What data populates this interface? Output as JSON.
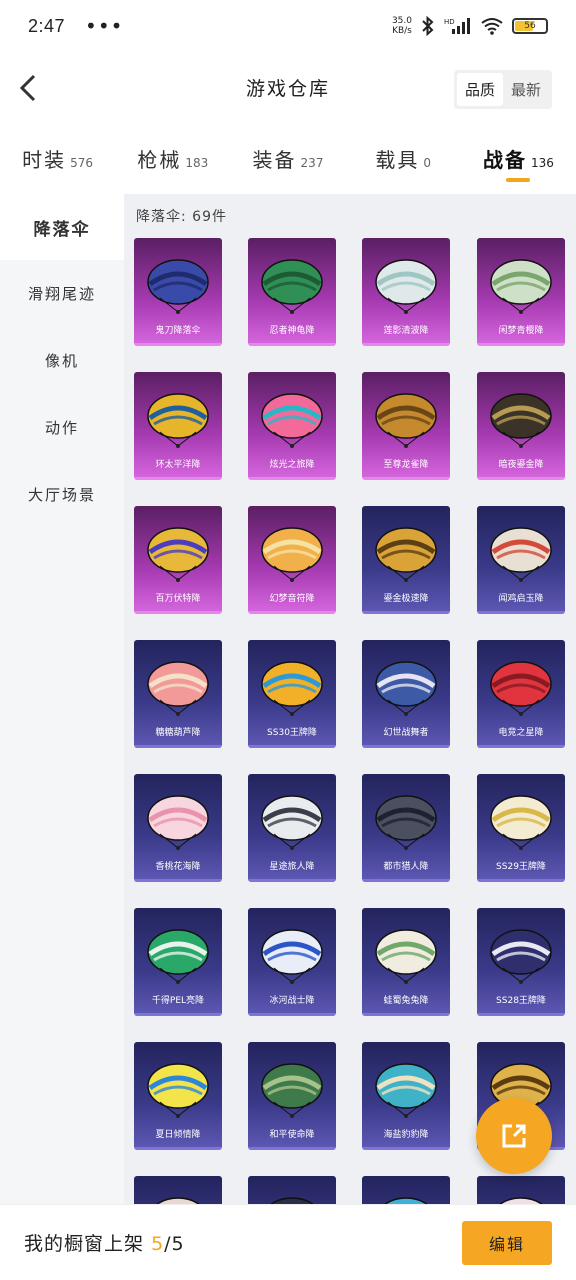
{
  "status": {
    "time": "2:47",
    "dots": "•••",
    "speed_value": "35.0",
    "speed_unit": "KB/s",
    "battery": "56"
  },
  "header": {
    "title": "游戏仓库",
    "sort_quality": "品质",
    "sort_newest": "最新"
  },
  "tabs": [
    {
      "label": "时装",
      "count": "576"
    },
    {
      "label": "枪械",
      "count": "183"
    },
    {
      "label": "装备",
      "count": "237"
    },
    {
      "label": "载具",
      "count": "0"
    },
    {
      "label": "战备",
      "count": "136"
    }
  ],
  "sidebar": [
    {
      "label": "降落伞"
    },
    {
      "label": "滑翔尾迹"
    },
    {
      "label": "像机"
    },
    {
      "label": "动作"
    },
    {
      "label": "大厅场景"
    }
  ],
  "content": {
    "count_label": "降落伞: 69件"
  },
  "items": [
    {
      "name": "鬼刀降落伞",
      "rarity": "epic",
      "colors": [
        "#3a4aa8",
        "#1e2b6e"
      ]
    },
    {
      "name": "忍者神龟降",
      "rarity": "epic",
      "colors": [
        "#2f8f54",
        "#1d5a35"
      ]
    },
    {
      "name": "莲影清波降",
      "rarity": "epic",
      "colors": [
        "#dfe9ea",
        "#9fc6c4"
      ]
    },
    {
      "name": "闲梦青樱降",
      "rarity": "epic",
      "colors": [
        "#cfe0c8",
        "#7aa56d"
      ]
    },
    {
      "name": "环太平洋降",
      "rarity": "epic",
      "colors": [
        "#e7b52a",
        "#1f5f9c"
      ]
    },
    {
      "name": "炫光之旅降",
      "rarity": "epic",
      "colors": [
        "#f36a9a",
        "#2bb6c8"
      ]
    },
    {
      "name": "至尊龙雀降",
      "rarity": "epic",
      "colors": [
        "#c58a2e",
        "#6a4516"
      ]
    },
    {
      "name": "暗夜鎏金降",
      "rarity": "epic",
      "colors": [
        "#3b3327",
        "#b79a53"
      ]
    },
    {
      "name": "百万伏特降",
      "rarity": "epic",
      "colors": [
        "#e8b83a",
        "#4b3cc0"
      ]
    },
    {
      "name": "幻梦音符降",
      "rarity": "epic",
      "colors": [
        "#f2b04a",
        "#f5e3a5"
      ]
    },
    {
      "name": "鎏金极速降",
      "rarity": "legend",
      "colors": [
        "#d9a338",
        "#5c3f12"
      ]
    },
    {
      "name": "闻鸡启玉降",
      "rarity": "legend",
      "colors": [
        "#e8e0d2",
        "#d34a3a"
      ]
    },
    {
      "name": "糖糖葫芦降",
      "rarity": "legend",
      "colors": [
        "#f29a9a",
        "#f5e0c8"
      ]
    },
    {
      "name": "SS30王牌降",
      "rarity": "legend",
      "colors": [
        "#f1b028",
        "#2d9ad6"
      ]
    },
    {
      "name": "幻世战舞者",
      "rarity": "legend",
      "colors": [
        "#3c5aa6",
        "#e7e3f2"
      ]
    },
    {
      "name": "电竞之星降",
      "rarity": "legend",
      "colors": [
        "#e0343e",
        "#8a1a22"
      ]
    },
    {
      "name": "香桃花海降",
      "rarity": "legend",
      "colors": [
        "#f7d6df",
        "#e993ad"
      ]
    },
    {
      "name": "星途旅人降",
      "rarity": "legend",
      "colors": [
        "#e8ecef",
        "#3a3e48"
      ]
    },
    {
      "name": "都市猎人降",
      "rarity": "legend",
      "colors": [
        "#4a5060",
        "#1e2230"
      ]
    },
    {
      "name": "SS29王牌降",
      "rarity": "legend",
      "colors": [
        "#f3ecd2",
        "#d9b84a"
      ]
    },
    {
      "name": "千得PEL亮降",
      "rarity": "legend",
      "colors": [
        "#2aa86a",
        "#e8f3ed"
      ]
    },
    {
      "name": "冰河战士降",
      "rarity": "legend",
      "colors": [
        "#e9edf7",
        "#2c55c8"
      ]
    },
    {
      "name": "蛙蜀兔兔降",
      "rarity": "legend",
      "colors": [
        "#f1ece0",
        "#6fa86a"
      ]
    },
    {
      "name": "SS28王牌降",
      "rarity": "legend",
      "colors": [
        "#2f2f6e",
        "#e9e9f3"
      ]
    },
    {
      "name": "夏日倾情降",
      "rarity": "legend",
      "colors": [
        "#f3e44a",
        "#2e86d9"
      ]
    },
    {
      "name": "和平使命降",
      "rarity": "legend",
      "colors": [
        "#3f7a4a",
        "#a7c38c"
      ]
    },
    {
      "name": "海盐豹豹降",
      "rarity": "legend",
      "colors": [
        "#3fb2c8",
        "#f0e2c0"
      ]
    },
    {
      "name": "",
      "rarity": "legend",
      "colors": [
        "#e0b24a",
        "#5a3a0f"
      ]
    },
    {
      "name": "",
      "rarity": "legend",
      "colors": [
        "#e8d8d0",
        "#c94b5b"
      ]
    },
    {
      "name": "",
      "rarity": "legend",
      "colors": [
        "#2a2f48",
        "#4a4f70"
      ]
    },
    {
      "name": "",
      "rarity": "legend",
      "colors": [
        "#3fb0d8",
        "#e38a2a"
      ]
    },
    {
      "name": "",
      "rarity": "legend",
      "colors": [
        "#f0e0e6",
        "#b98aa0"
      ]
    }
  ],
  "bottom": {
    "showcase_label": "我的橱窗上架",
    "showcase_current": "5",
    "showcase_total": "/5",
    "edit_label": "编辑"
  },
  "accent": "#f5a623"
}
